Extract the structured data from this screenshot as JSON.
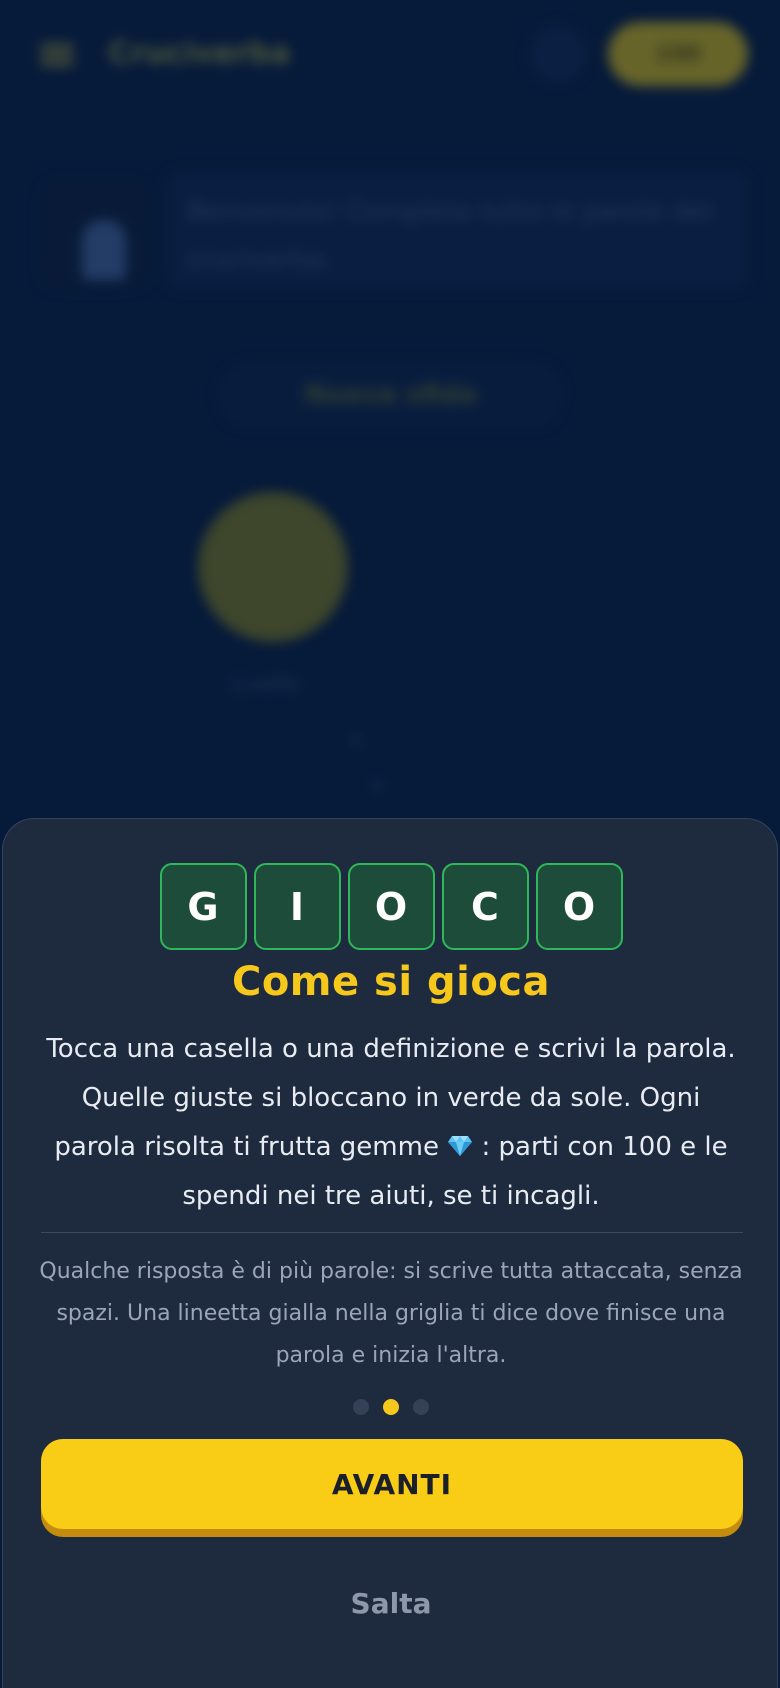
{
  "background": {
    "header_title": "Cruciverba",
    "gem_count": "100",
    "info_text": "Benvenuto! Completa tutte le parole del cruciverba.",
    "action_pill": "Nuova sfida",
    "caption": "Livello"
  },
  "sheet": {
    "tiles": [
      "G",
      "I",
      "O",
      "C",
      "O"
    ],
    "title": "Come si gioca",
    "body_line1": "Tocca una casella o una definizione e scrivi la parola. Quelle giuste si bloccano in verde da sole. Ogni parola risolta ti frutta gemme",
    "body_line2": ": parti con 100 e le spendi nei tre aiuti, se ti incagli.",
    "note": "Qualche risposta è di più parole: si scrive tutta attaccata, senza spazi. Una lineetta gialla nella griglia ti dice dove finisce una parola e inizia l'altra.",
    "page_index": 2,
    "page_count": 3,
    "primary_button": "AVANTI",
    "skip_button": "Salta"
  },
  "colors": {
    "accent_yellow": "#f9cc15",
    "tile_green": "#1e4c3a",
    "tile_border": "#2fb859",
    "sheet_bg": "#1e2a3e"
  },
  "icons": {
    "gem": "gem-icon"
  }
}
